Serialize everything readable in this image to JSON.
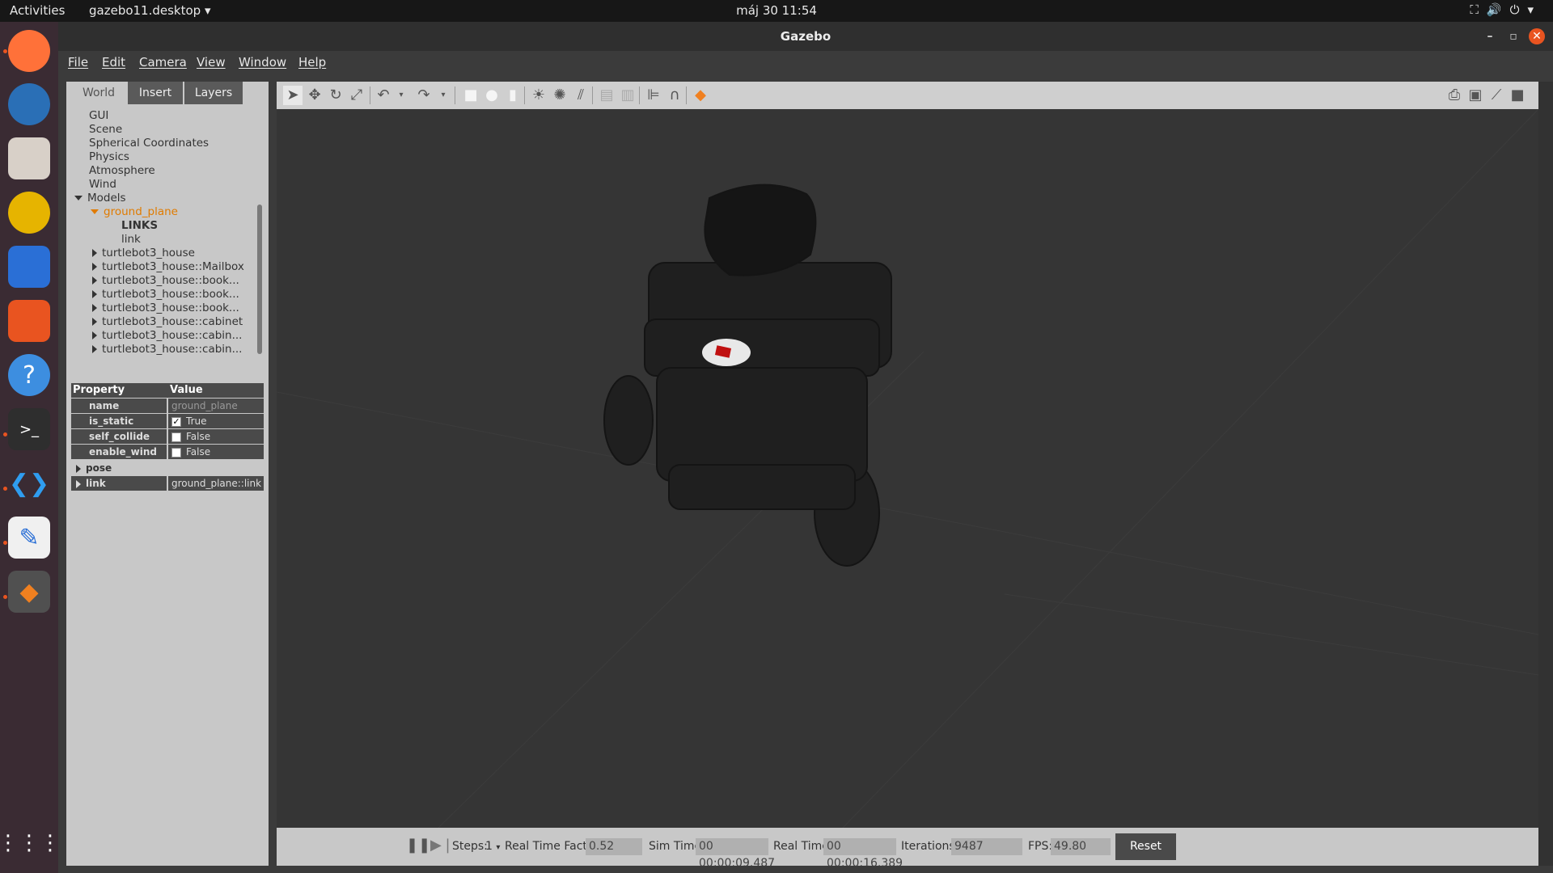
{
  "topbar": {
    "activities": "Activities",
    "app_menu": "gazebo11.desktop",
    "clock": "máj 30  11:54"
  },
  "window": {
    "title": "Gazebo"
  },
  "menu": {
    "file": "File",
    "edit": "Edit",
    "camera": "Camera",
    "view": "View",
    "window": "Window",
    "help": "Help"
  },
  "tabs": {
    "world": "World",
    "insert": "Insert",
    "layers": "Layers"
  },
  "tree": {
    "gui": "GUI",
    "scene": "Scene",
    "spherical": "Spherical Coordinates",
    "physics": "Physics",
    "atmosphere": "Atmosphere",
    "wind": "Wind",
    "models": "Models",
    "ground_plane": "ground_plane",
    "links": "LINKS",
    "link": "link",
    "m1": "turtlebot3_house",
    "m2": "turtlebot3_house::Mailbox",
    "m3": "turtlebot3_house::book...",
    "m4": "turtlebot3_house::book...",
    "m5": "turtlebot3_house::book...",
    "m6": "turtlebot3_house::cabinet",
    "m7": "turtlebot3_house::cabin...",
    "m8": "turtlebot3_house::cabin..."
  },
  "props": {
    "header_property": "Property",
    "header_value": "Value",
    "name_k": "name",
    "name_v": "ground_plane",
    "static_k": "is_static",
    "static_v": "True",
    "collide_k": "self_collide",
    "collide_v": "False",
    "wind_k": "enable_wind",
    "wind_v": "False",
    "pose_k": "pose",
    "link_k": "link",
    "link_v": "ground_plane::link"
  },
  "bottom": {
    "steps_label": "Steps:",
    "steps_value": "1",
    "rtf_label": "Real Time Factor:",
    "rtf_value": "0.52",
    "sim_label": "Sim Time:",
    "sim_value": "00 00:00:09.487",
    "real_label": "Real Time:",
    "real_value": "00 00:00:16.389",
    "iter_label": "Iterations:",
    "iter_value": "9487",
    "fps_label": "FPS:",
    "fps_value": "49.80",
    "reset": "Reset Time"
  }
}
